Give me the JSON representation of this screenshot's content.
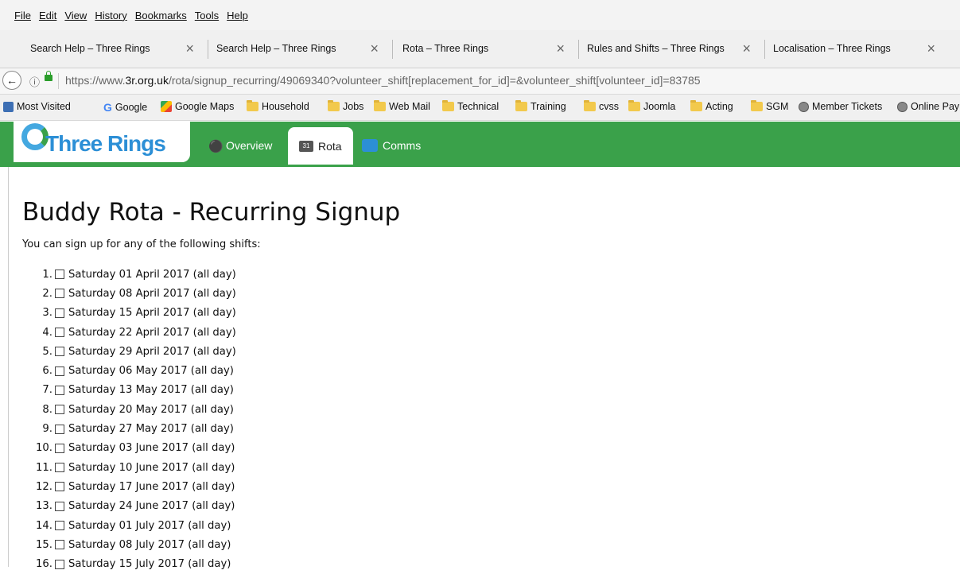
{
  "browser": {
    "menu": [
      "File",
      "Edit",
      "View",
      "History",
      "Bookmarks",
      "Tools",
      "Help"
    ],
    "tabs": [
      {
        "title": "Search Help – Three Rings"
      },
      {
        "title": "Search Help – Three Rings"
      },
      {
        "title": "Rota – Three Rings"
      },
      {
        "title": "Rules and Shifts – Three Rings"
      },
      {
        "title": "Localisation – Three Rings"
      }
    ],
    "tab_close_glyph": "×",
    "address": {
      "prefix": "https://www.",
      "host": "3r.org.uk",
      "path": "/rota/signup_recurring/49069340?volunteer_shift[replacement_for_id]=&volunteer_shift[volunteer_id]=83785"
    },
    "bookmarks": [
      {
        "label": "Most Visited",
        "icon": "square-icon"
      },
      {
        "label": "Google",
        "icon": "google-icon"
      },
      {
        "label": "Google Maps",
        "icon": "maps-icon"
      },
      {
        "label": "Household",
        "icon": "folder-icon"
      },
      {
        "label": "Jobs",
        "icon": "folder-icon"
      },
      {
        "label": "Web Mail",
        "icon": "folder-icon"
      },
      {
        "label": "Technical",
        "icon": "folder-icon"
      },
      {
        "label": "Training",
        "icon": "folder-icon"
      },
      {
        "label": "cvss",
        "icon": "folder-icon"
      },
      {
        "label": "Joomla",
        "icon": "folder-icon"
      },
      {
        "label": "Acting",
        "icon": "folder-icon"
      },
      {
        "label": "SGM",
        "icon": "folder-icon"
      },
      {
        "label": "Member Tickets",
        "icon": "globe-icon"
      },
      {
        "label": "Online Paym",
        "icon": "globe-icon"
      }
    ]
  },
  "site": {
    "logo_text": "Three Rings",
    "nav": [
      {
        "label": "Overview",
        "icon": "footprint-icon",
        "active": false
      },
      {
        "label": "Rota",
        "icon": "calendar-icon",
        "active": true
      },
      {
        "label": "Comms",
        "icon": "comms-icon",
        "active": false
      }
    ],
    "brand_color": "#3aa14a"
  },
  "page": {
    "title": "Buddy Rota - Recurring Signup",
    "intro": "You can sign up for any of the following shifts:",
    "shifts": [
      {
        "num": "1.",
        "label": "Saturday 01 April 2017 (all day)"
      },
      {
        "num": "2.",
        "label": "Saturday 08 April 2017 (all day)"
      },
      {
        "num": "3.",
        "label": "Saturday 15 April 2017 (all day)"
      },
      {
        "num": "4.",
        "label": "Saturday 22 April 2017 (all day)"
      },
      {
        "num": "5.",
        "label": "Saturday 29 April 2017 (all day)"
      },
      {
        "num": "6.",
        "label": "Saturday 06 May 2017 (all day)"
      },
      {
        "num": "7.",
        "label": "Saturday 13 May 2017 (all day)"
      },
      {
        "num": "8.",
        "label": "Saturday 20 May 2017 (all day)"
      },
      {
        "num": "9.",
        "label": "Saturday 27 May 2017 (all day)"
      },
      {
        "num": "10.",
        "label": "Saturday 03 June 2017 (all day)"
      },
      {
        "num": "11.",
        "label": "Saturday 10 June 2017 (all day)"
      },
      {
        "num": "12.",
        "label": "Saturday 17 June 2017 (all day)"
      },
      {
        "num": "13.",
        "label": "Saturday 24 June 2017 (all day)"
      },
      {
        "num": "14.",
        "label": "Saturday 01 July 2017 (all day)"
      },
      {
        "num": "15.",
        "label": "Saturday 08 July 2017 (all day)"
      },
      {
        "num": "16.",
        "label": "Saturday 15 July 2017 (all day)"
      }
    ]
  }
}
